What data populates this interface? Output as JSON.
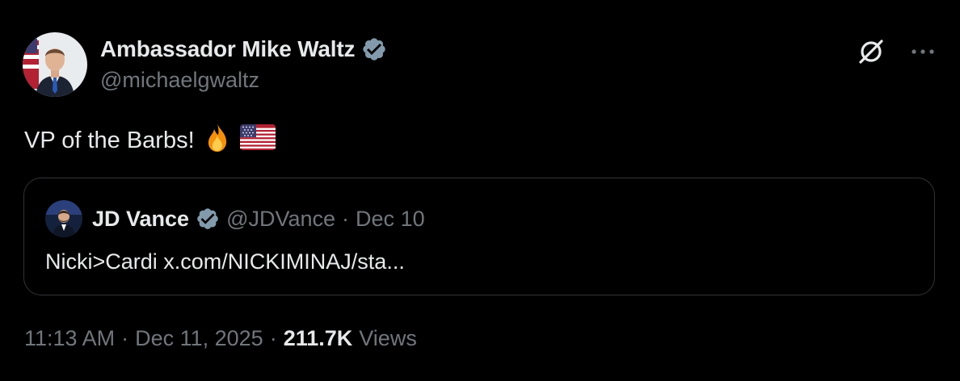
{
  "author": {
    "display_name": "Ambassador Mike Waltz",
    "handle": "@michaelgwaltz",
    "verified": true
  },
  "tweet": {
    "text": "VP of the Barbs!",
    "emojis": [
      "fire-emoji",
      "us-flag-emoji"
    ]
  },
  "quote": {
    "display_name": "JD Vance",
    "handle": "@JDVance",
    "separator": "·",
    "date": "Dec 10",
    "text": "Nicki>Cardi x.com/NICKIMINAJ/sta..."
  },
  "meta": {
    "time": "11:13 AM",
    "separator1": "·",
    "date": "Dec 11, 2025",
    "separator2": "·",
    "views_count": "211.7K",
    "views_label": "Views"
  },
  "icons": {
    "grok": "grok-icon",
    "more": "more-icon",
    "verified": "verified-badge-icon"
  },
  "colors": {
    "background": "#000000",
    "text_primary": "#e7e9ea",
    "text_secondary": "#71767b",
    "verified_badge": "#829aab",
    "border": "#2f3336"
  }
}
